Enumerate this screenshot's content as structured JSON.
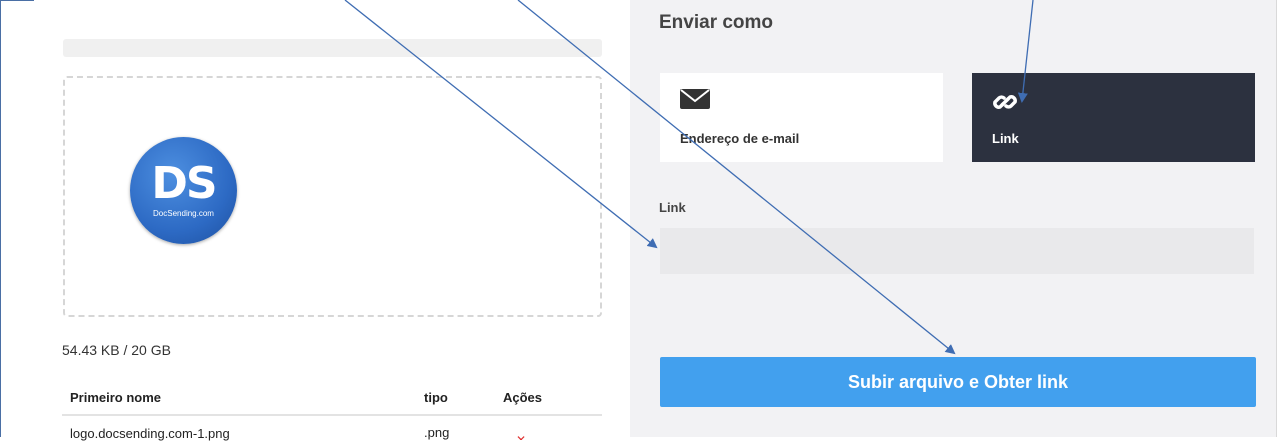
{
  "upload": {
    "progress_percent": 0,
    "storage_text": "54.43 KB / 20 GB",
    "logo": {
      "monogram": "DS",
      "caption": "DocSending.com"
    },
    "table": {
      "headers": [
        "Primeiro nome",
        "tipo",
        "Ações"
      ],
      "rows": [
        {
          "name": "logo.docsending.com-1.png",
          "type": ".png"
        }
      ]
    }
  },
  "send": {
    "title": "Enviar como",
    "options": [
      {
        "label": "Endereço de e-mail",
        "icon": "envelope-icon",
        "selected": false
      },
      {
        "label": "Link",
        "icon": "link-icon",
        "selected": true
      }
    ],
    "link_field": {
      "label": "Link",
      "value": "",
      "placeholder": ""
    },
    "submit_label": "Subir arquivo e Obter link"
  },
  "colors": {
    "accent": "#42a0ee",
    "selected_card": "#2c313f",
    "panel": "#f2f2f4",
    "annotation": "#3f6db3",
    "delete": "#e03131"
  }
}
